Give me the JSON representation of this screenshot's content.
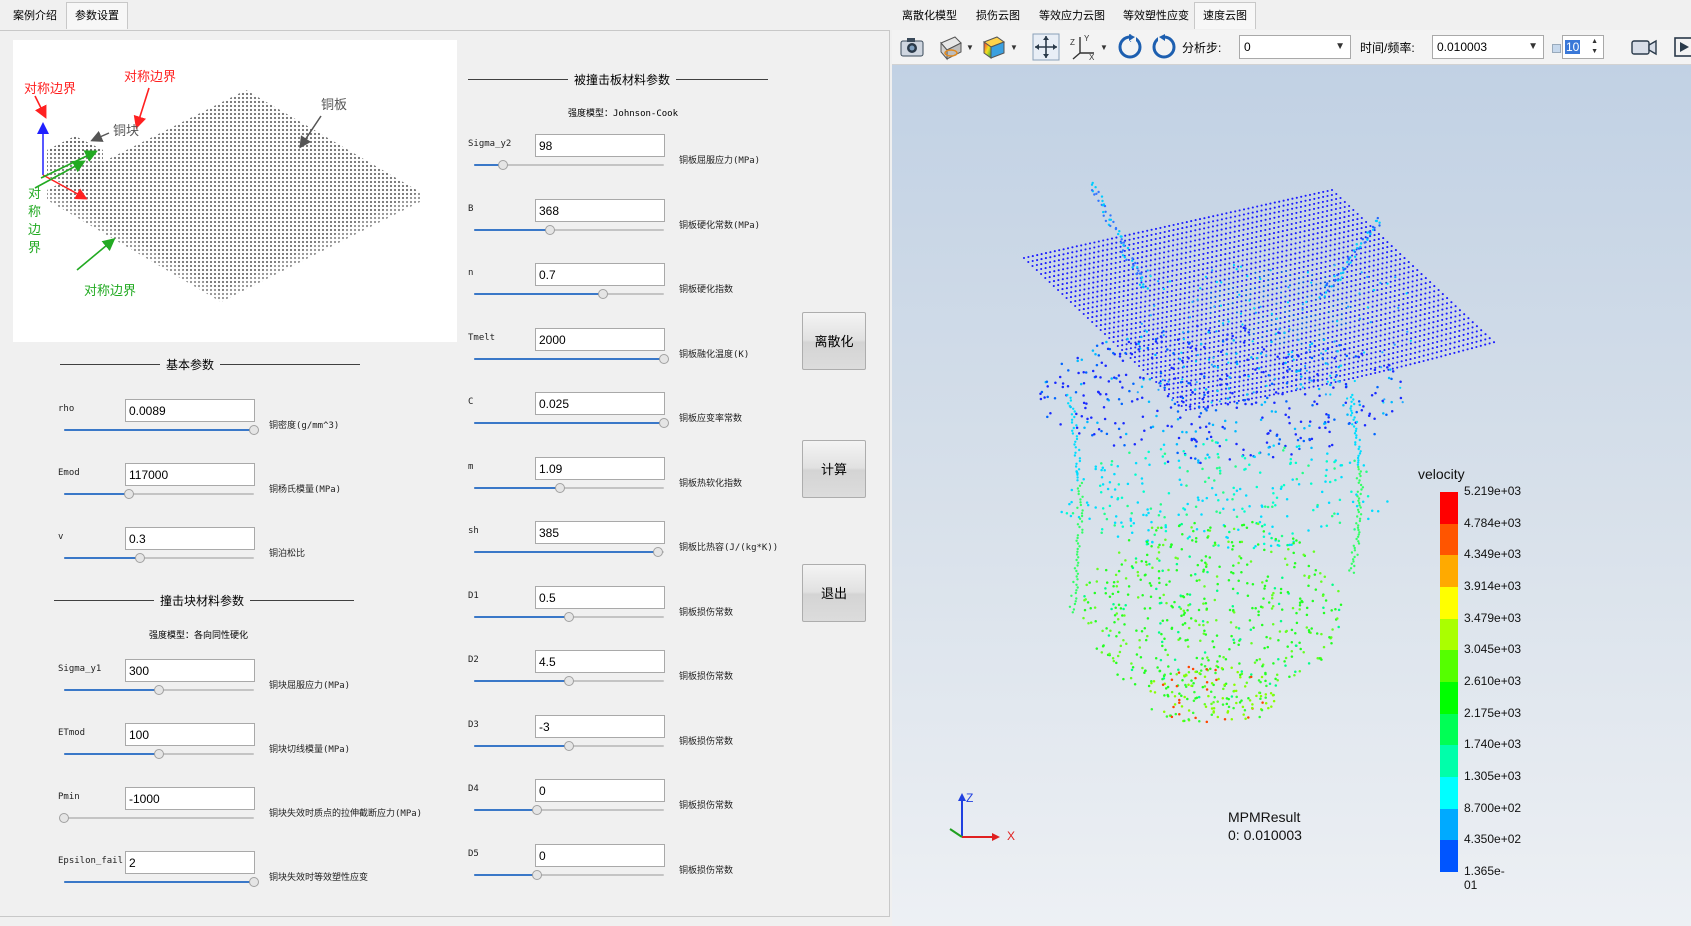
{
  "left_tabs": [
    "案例介绍",
    "参数设置"
  ],
  "right_tabs": [
    "离散化模型",
    "损伤云图",
    "等效应力云图",
    "等效塑性应变",
    "速度云图"
  ],
  "diagram": {
    "labels": {
      "sym_top_left": "对称边界",
      "sym_top_mid": "对称边界",
      "copper_plate": "铜板",
      "copper_block": "铜块",
      "sym_vertical": [
        "对",
        "称",
        "边",
        "界"
      ],
      "sym_bottom": "对称边界"
    },
    "colors": {
      "red": "#ff2020",
      "green": "#22aa22",
      "gray": "#555555"
    }
  },
  "basic": {
    "title": "基本参数",
    "params": [
      {
        "name": "rho",
        "value": "0.0089",
        "desc": "铜密度(g/mm^3)",
        "level": 1.0
      },
      {
        "name": "Emod",
        "value": "117000",
        "desc": "铜杨氏模量(MPa)",
        "level": 0.34
      },
      {
        "name": "v",
        "value": "0.3",
        "desc": "铜泊松比",
        "level": 0.4
      }
    ]
  },
  "block": {
    "title": "撞击块材料参数",
    "model": "强度模型：各向同性硬化",
    "params": [
      {
        "name": "Sigma_y1",
        "value": "300",
        "desc": "铜块屈服应力(MPa)",
        "level": 0.5
      },
      {
        "name": "ETmod",
        "value": "100",
        "desc": "铜块切线模量(MPa)",
        "level": 0.5
      },
      {
        "name": "Pmin",
        "value": "-1000",
        "desc": "铜块失效时质点的拉伸截断应力(MPa)",
        "level": 0.0
      },
      {
        "name": "Epsilon_fail",
        "value": "2",
        "desc": "铜块失效时等效塑性应变",
        "level": 1.0
      }
    ]
  },
  "plate": {
    "title": "被撞击板材料参数",
    "model": "强度模型：Johnson-Cook",
    "params": [
      {
        "name": "Sigma_y2",
        "value": "98",
        "desc": "铜板屈服应力(MPa)",
        "level": 0.15
      },
      {
        "name": "B",
        "value": "368",
        "desc": "铜板硬化常数(MPa)",
        "level": 0.4
      },
      {
        "name": "n",
        "value": "0.7",
        "desc": "铜板硬化指数",
        "level": 0.68
      },
      {
        "name": "Tmelt",
        "value": "2000",
        "desc": "铜板融化温度(K)",
        "level": 1.0
      },
      {
        "name": "C",
        "value": "0.025",
        "desc": "铜板应变率常数",
        "level": 1.0
      },
      {
        "name": "m",
        "value": "1.09",
        "desc": "铜板热软化指数",
        "level": 0.45
      },
      {
        "name": "sh",
        "value": "385",
        "desc": "铜板比热容(J/(kg*K))",
        "level": 0.97
      },
      {
        "name": "D1",
        "value": "0.5",
        "desc": "铜板损伤常数",
        "level": 0.5
      },
      {
        "name": "D2",
        "value": "4.5",
        "desc": "铜板损伤常数",
        "level": 0.5
      },
      {
        "name": "D3",
        "value": "-3",
        "desc": "铜板损伤常数",
        "level": 0.5
      },
      {
        "name": "D4",
        "value": "0",
        "desc": "铜板损伤常数",
        "level": 0.33
      },
      {
        "name": "D5",
        "value": "0",
        "desc": "铜板损伤常数",
        "level": 0.33
      }
    ]
  },
  "buttons": {
    "discretize": "离散化",
    "compute": "计算",
    "exit": "退出"
  },
  "toolbar": {
    "step_label": "分析步:",
    "step_value": "0",
    "time_label": "时间/频率:",
    "time_value": "0.010003",
    "spin_value": "10"
  },
  "view": {
    "axes": {
      "z": "Z",
      "x": "X",
      "y": "Y"
    },
    "result_name": "MPMResult",
    "result_time": "0: 0.010003"
  },
  "legend": {
    "title": "velocity",
    "values": [
      "5.219e+03",
      "4.784e+03",
      "4.349e+03",
      "3.914e+03",
      "3.479e+03",
      "3.045e+03",
      "2.610e+03",
      "2.175e+03",
      "1.740e+03",
      "1.305e+03",
      "8.700e+02",
      "4.350e+02",
      "1.365e-01"
    ],
    "colors": [
      "#ff0000",
      "#ff5500",
      "#ffaa00",
      "#ffff00",
      "#aaff00",
      "#55ff00",
      "#00ff00",
      "#00ff55",
      "#00ffaa",
      "#00ffff",
      "#00aaff",
      "#0055ff",
      "#0000ff"
    ]
  }
}
